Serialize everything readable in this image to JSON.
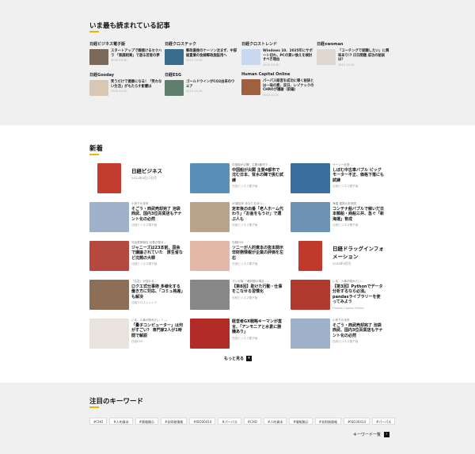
{
  "popular": {
    "title": "いま最も読まれている記事",
    "cards": [
      {
        "category": "日経ビジネス電子版",
        "title": "スタートアップで棘捌けるセクハラ 「無謀相乗」で遊る若者の夢",
        "date": "2022.10.20",
        "color": "#7a6a5a"
      },
      {
        "category": "日経クロステック",
        "title": "郵政最後のケーソン沈まず、中部総置業の金線郵政施設用へ",
        "date": "2022.10.20",
        "color": "#3a6d8c"
      },
      {
        "category": "日経クロストレンド",
        "title": "Windows 10、2025年にサポート切れ、PCの買い換えを検討すべき理由",
        "date": "2022.10.20",
        "color": "#c9d7f0"
      },
      {
        "category": "日経xwoman",
        "title": "「コーチングで就職したい」に興味あり!? 日日間題 成功の秘訣は？",
        "date": "2022.10.20",
        "color": "#e0d8d0"
      },
      {
        "category": "日経Gooday",
        "title": "笑うだけで健康になる！「笑わない生活」がもたらす影響は",
        "date": "2022.10.20",
        "color": "#d6c8b5"
      },
      {
        "category": "日経ESG",
        "title": "ゴールドウインがCO2由来のウエア",
        "date": "2022.10.20",
        "color": "#5f7f6e"
      },
      {
        "category": "Human Capital Online",
        "title": "パーパス経営を成功に導く秘訣とは一味の素、双日、レゾナックのCHROが議論（前編）",
        "date": "2022.10.20",
        "color": "#a0603f"
      }
    ]
  },
  "news": {
    "title": "新着",
    "items": [
      {
        "title": "日経ビジネス",
        "date": "2024年9月23日号",
        "color": "#c43b2f",
        "big": true
      },
      {
        "kicker": "中国船が尖閣　主要4都市で…",
        "title": "中国船が尖閣 主要4都市で 沈む日本、背水の陣で挑む試練",
        "source": "日経ビジネス電子版",
        "color": "#5b8fb8"
      },
      {
        "kicker": "ケーシー社長 ...",
        "title": "しぼむ中古車バブル ビッグモーター不正、価格下落にも試練",
        "source": "日経ビジネス電子版",
        "color": "#3b6fa0"
      },
      {
        "kicker": "小売りの未来",
        "title": "そごう・西武売却完了 池袋西武、国内3位百貨店もテナント化の必然",
        "source": "日経ビジネス電子版",
        "color": "#9fb1c9"
      },
      {
        "kicker": "50歳定年 あなたを待つ…",
        "title": "定年後の出番「老人ホーム代わり」「お金をもうけ」で選ぶ人も",
        "source": "日経ビジネス電子版",
        "color": "#b9a38a"
      },
      {
        "kicker": "海運 運賃の未来図",
        "title": "コンテナ船バブルで稼いだ日本郵船・商船三井、急ぐ「新海運」育成",
        "source": "日経ビジネス電子版",
        "color": "#6f93b5"
      },
      {
        "kicker": "河出書房新社 社長が語る…",
        "title": "ジャニーズは23本前、国会で議論されていた　厚生省など沈黙の大罪",
        "source": "日経ビジネス電子版",
        "color": "#b5483f"
      },
      {
        "kicker": "日経ESG",
        "title": "ソニーが人的資本の抜本開示 非財務情報が企業の評価を左右",
        "source": "日経ビジネス電子版",
        "color": "#e3b8a8"
      },
      {
        "title": "日経ドラッグインフォメーション",
        "date": "2024年9月号",
        "color": "#c0392b",
        "big": true
      },
      {
        "kicker": "「広告」が変わる…",
        "title": "ロクエ式仕事術 多様化する働き方に対応、「コミュ格差」も解決",
        "source": "日経クロストレンド",
        "color": "#8d6f58"
      },
      {
        "kicker": "マンガ版 「格好優の場合…」",
        "title": "【第8回】助けた行動・仕事をこなせる習慣化",
        "source": "日経ビジネス電子版",
        "color": "#888888"
      },
      {
        "kicker": "いま、人事が読みたい…",
        "title": "【第3回】Pythonでデータ分析するなら必須。pandasライブラリーを使ってみよう",
        "source": "Human Capital Online",
        "color": "#b03a2e"
      },
      {
        "kicker": "いま、人事が読みたい「…」",
        "title": "「量子コンピューター」は何がすごい？ 専門家2人が1時間で解説",
        "source": "日経ESG",
        "color": "#e8e4dd"
      },
      {
        "kicker": "",
        "title": "経営者GX戦略キーマンが直言、「アンモニアと水素に勝機あり」",
        "source": "日経ビジネス電子版",
        "color": "#b22b26"
      },
      {
        "kicker": "小売りの未来",
        "title": "そごう・西武売却完了 池袋西武、国内3位百貨店もテナント化の必然",
        "source": "日経ビジネス電子版",
        "color": "#9fb1c9"
      }
    ],
    "more_label": "もっと見る"
  },
  "keywords": {
    "title": "注目のキーワード",
    "tags": [
      "#CHO",
      "#人的資本",
      "#情報開示",
      "#非財務情報",
      "#ISO30414",
      "#パーパス",
      "#CHO",
      "#人的資本",
      "#情報開示",
      "#非財務情報",
      "#ISO30414",
      "#パーパス"
    ],
    "list_label": "キーワード一覧"
  }
}
